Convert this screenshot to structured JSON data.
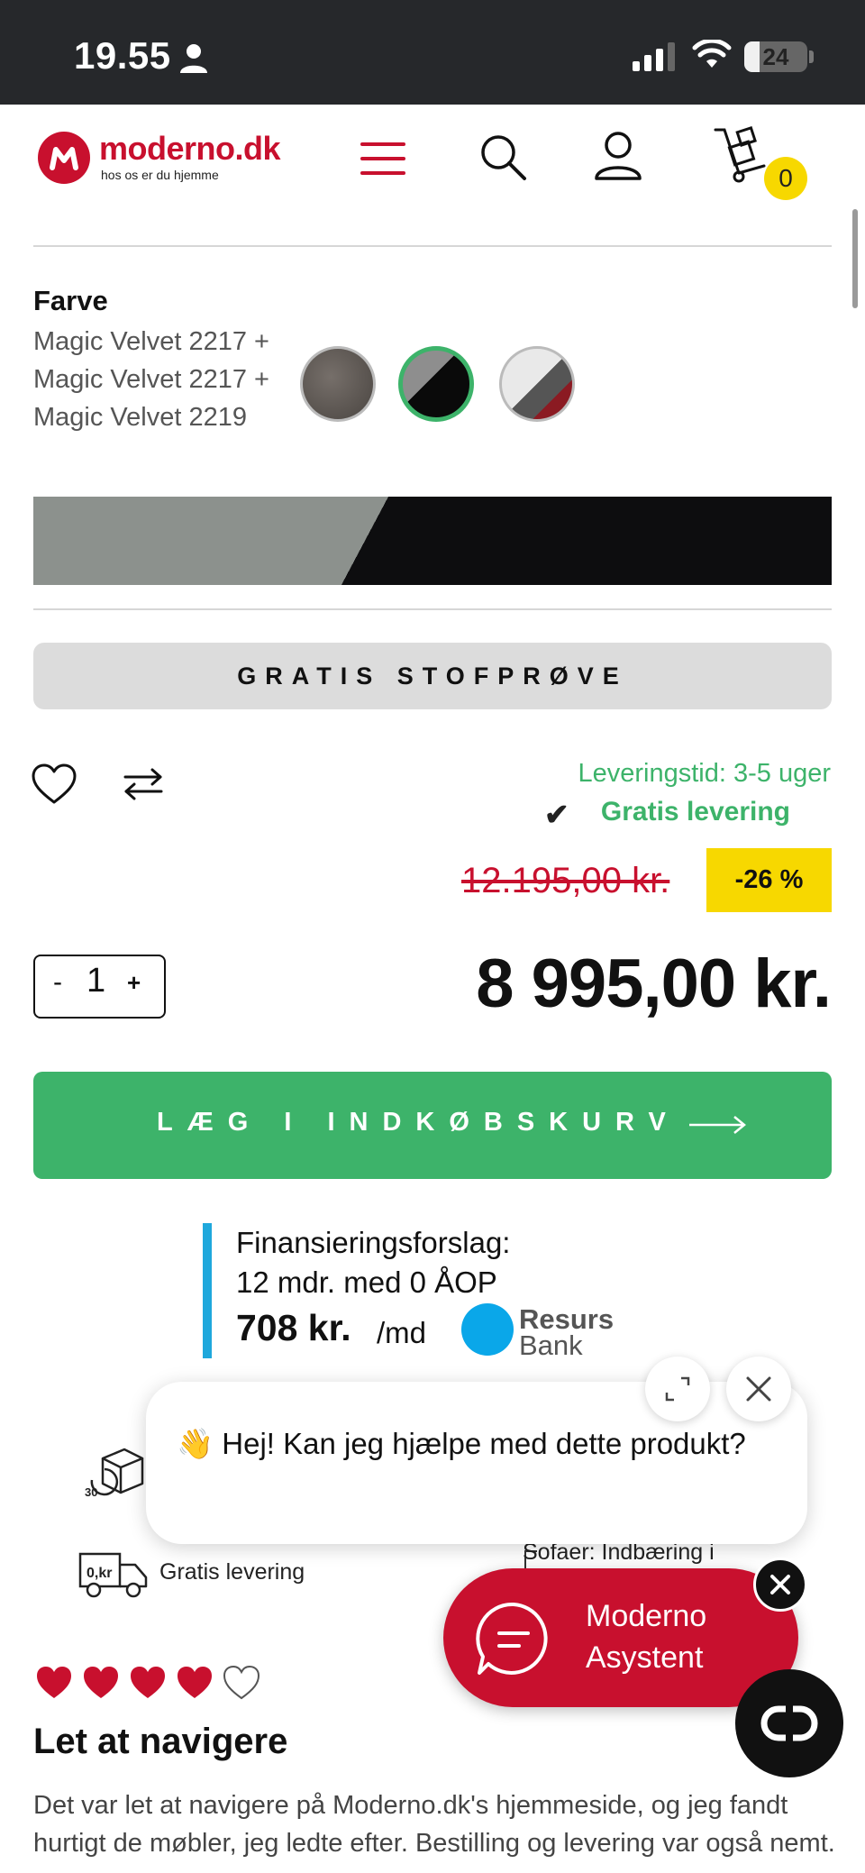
{
  "status_bar": {
    "time": "19.55",
    "battery": "24",
    "battery_level": 0.24
  },
  "header": {
    "logo_text": "moderno.dk",
    "logo_tagline": "hos os er du hjemme",
    "cart_count": "0"
  },
  "color_selector": {
    "heading": "Farve",
    "selected_name": "Magic Velvet 2217 + Magic Velvet 2217 + Magic Velvet 2219",
    "swatches": [
      "grey-brown",
      "grey-black",
      "white-grey-red"
    ],
    "selected_index": 1
  },
  "sample_button": "GRATIS STOFPRØVE",
  "delivery": {
    "time": "Leveringstid: 3-5 uger",
    "free": "Gratis levering",
    "check": "✔"
  },
  "pricing": {
    "old_price": "12.195,00 kr.",
    "discount": "-26 %",
    "price": "8 995,00 kr."
  },
  "quantity": {
    "minus": "-",
    "value": "1",
    "plus": "+"
  },
  "add_to_cart": "LÆG I INDKØBSKURV",
  "finance": {
    "title": "Finansieringsforslag:",
    "subtitle": "12 mdr. med 0 ÅOP",
    "amount": "708 kr.",
    "per": "/md",
    "provider_line1": "Resurs",
    "provider_line2": "Bank"
  },
  "features": {
    "free_delivery": "Gratis levering",
    "sofa_note": "Sofaer: Indbæring i"
  },
  "chat": {
    "message": "👋 Hej! Kan jeg hjælpe med dette produkt?",
    "assistant_line1": "Moderno",
    "assistant_line2": "Asystent"
  },
  "review": {
    "rating": 4,
    "max_rating": 5,
    "title": "Let at navigere",
    "body": "Det var let at navigere på Moderno.dk's hjemmeside, og jeg fandt hurtigt de møbler, jeg ledte efter. Bestilling og levering var også nemt."
  },
  "colors": {
    "brand_red": "#c8102e",
    "green": "#3db36a",
    "yellow": "#f7d800",
    "finance_blue": "#1fa8dc"
  }
}
